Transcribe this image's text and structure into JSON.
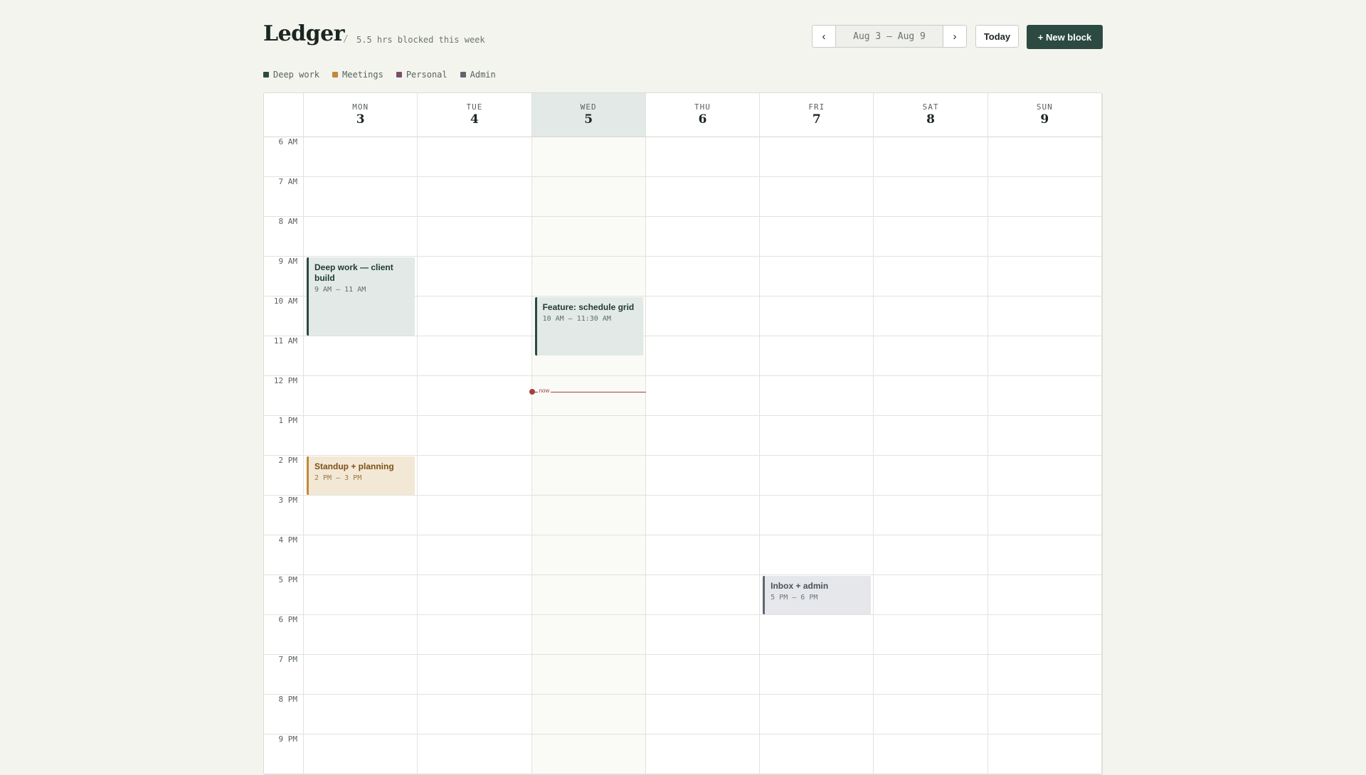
{
  "header": {
    "title": "Ledger",
    "separator": "/",
    "subtitle": "5.5 hrs blocked this week",
    "prev_label": "‹",
    "range_label": "Aug 3 – Aug 9",
    "next_label": "›",
    "today_label": "Today",
    "new_label": "+ New block"
  },
  "legend": [
    {
      "label": "Deep work",
      "color": "#2c4a42"
    },
    {
      "label": "Meetings",
      "color": "#c28a36"
    },
    {
      "label": "Personal",
      "color": "#7a4f6a"
    },
    {
      "label": "Admin",
      "color": "#5f6670"
    }
  ],
  "days": [
    {
      "dow": "MON",
      "num": "3",
      "today": false
    },
    {
      "dow": "TUE",
      "num": "4",
      "today": false
    },
    {
      "dow": "WED",
      "num": "5",
      "today": true
    },
    {
      "dow": "THU",
      "num": "6",
      "today": false
    },
    {
      "dow": "FRI",
      "num": "7",
      "today": false
    },
    {
      "dow": "SAT",
      "num": "8",
      "today": false
    },
    {
      "dow": "SUN",
      "num": "9",
      "today": false
    }
  ],
  "hours": [
    "6 AM",
    "7 AM",
    "8 AM",
    "9 AM",
    "10 AM",
    "11 AM",
    "12 PM",
    "1 PM",
    "2 PM",
    "3 PM",
    "4 PM",
    "5 PM",
    "6 PM",
    "7 PM",
    "8 PM",
    "9 PM"
  ],
  "events": [
    {
      "day": 0,
      "start": 9,
      "end": 11,
      "kind": "deep",
      "title": "Deep work — client build",
      "time": "9 AM – 11 AM"
    },
    {
      "day": 2,
      "start": 10,
      "end": 11.5,
      "kind": "deep",
      "title": "Feature: schedule grid",
      "time": "10 AM – 11:30 AM"
    },
    {
      "day": 0,
      "start": 14,
      "end": 15,
      "kind": "meet",
      "title": "Standup + planning",
      "time": "2 PM – 3 PM"
    },
    {
      "day": 4,
      "start": 17,
      "end": 18,
      "kind": "admin",
      "title": "Inbox + admin",
      "time": "5 PM – 6 PM"
    }
  ],
  "now": {
    "day": 2,
    "time": 12.4,
    "label": "now"
  }
}
